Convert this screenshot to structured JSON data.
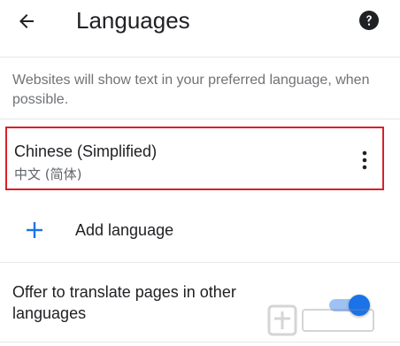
{
  "header": {
    "title": "Languages",
    "back_icon": "arrow-back-icon",
    "help_icon": "help-icon"
  },
  "description": "Websites will show text in your preferred language, when possible.",
  "languages": [
    {
      "name": "Chinese (Simplified)",
      "native_name": "中文 (简体)",
      "menu_icon": "more-vert-icon"
    }
  ],
  "add_language": {
    "label": "Add language",
    "icon": "plus-icon"
  },
  "translate_offer": {
    "label": "Offer to translate pages in other languages",
    "enabled": true
  },
  "colors": {
    "accent": "#1a73e8",
    "highlight_border": "#d9202a",
    "secondary_text": "#6f7276",
    "divider": "#e6e6e6"
  }
}
